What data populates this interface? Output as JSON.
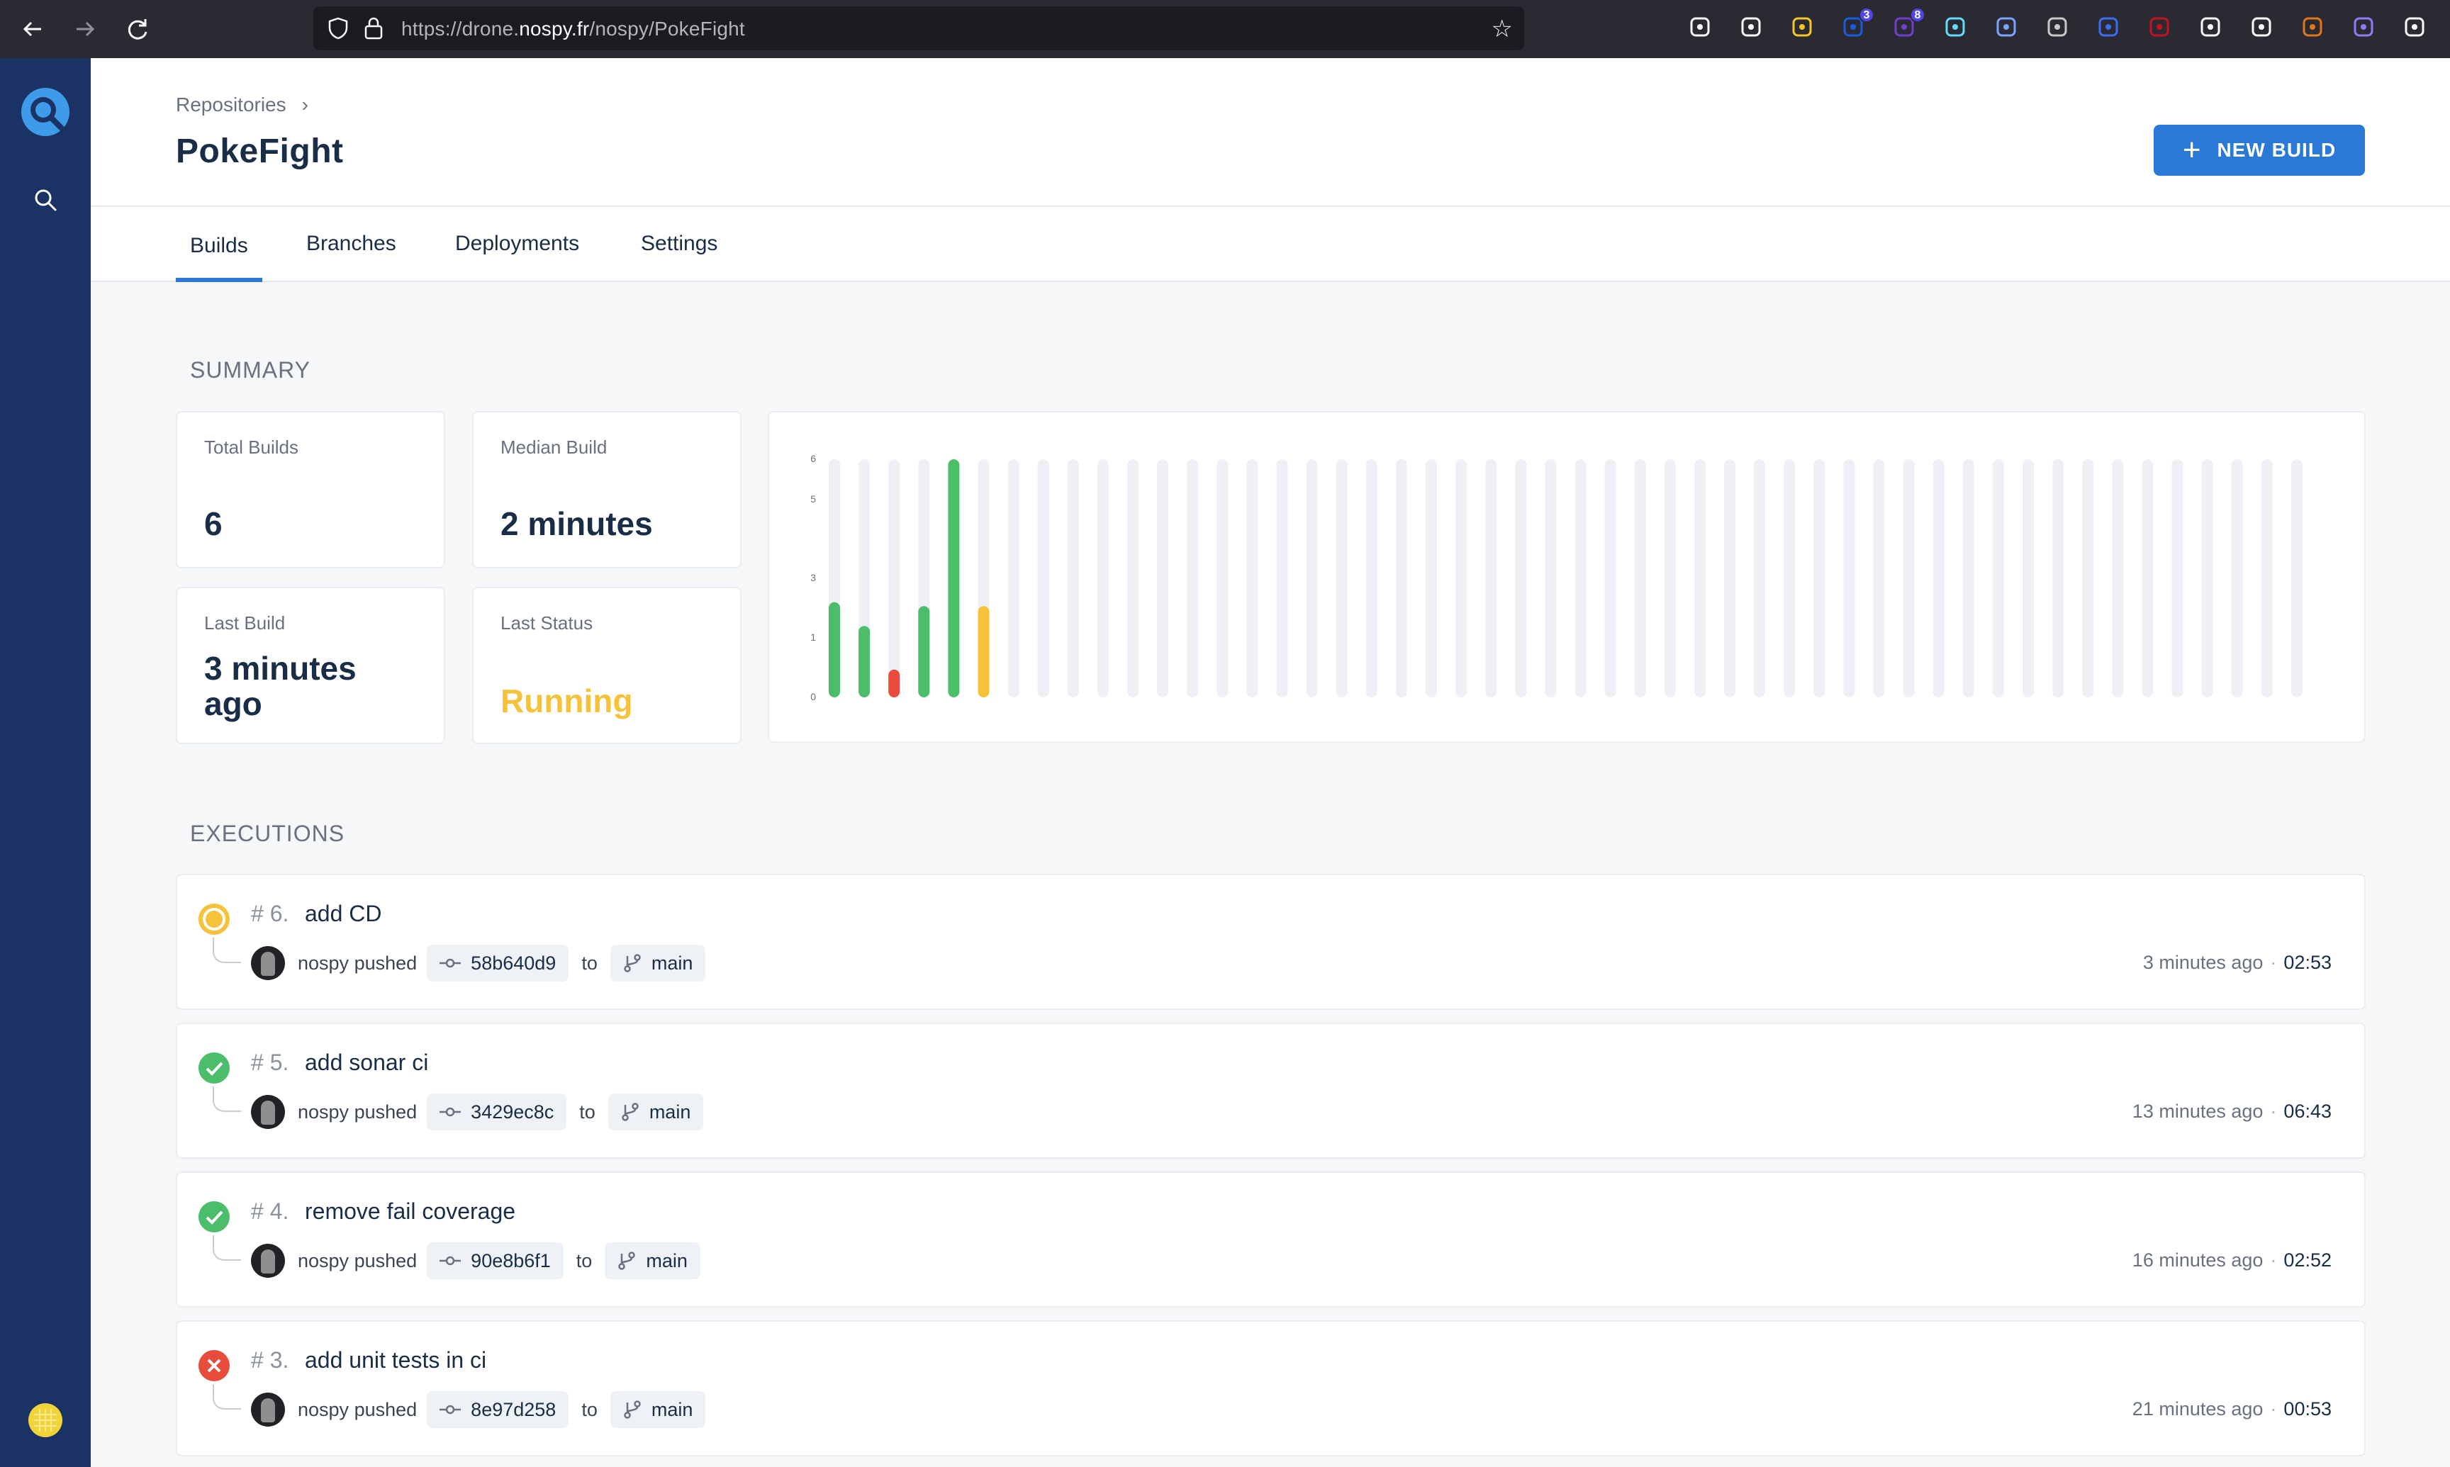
{
  "browser": {
    "url_prefix": "https://drone.",
    "url_domain": "nospy.fr",
    "url_path": "/nospy/PokeFight",
    "extensions": [
      {
        "icon": "pocket-icon",
        "color": "#fbfbfe"
      },
      {
        "icon": "download-icon",
        "color": "#fbfbfe"
      },
      {
        "icon": "wrench-icon",
        "color": "#f3c623"
      },
      {
        "icon": "bitwarden-icon",
        "color": "#175ddc",
        "badge": "3"
      },
      {
        "icon": "extension-purple-icon",
        "color": "#6d3fcf",
        "badge": "8"
      },
      {
        "icon": "react-devtools-icon",
        "color": "#61dafb"
      },
      {
        "icon": "graph-icon",
        "color": "#7aa2ff"
      },
      {
        "icon": "vue-devtools-icon",
        "color": "#c8c8c8"
      },
      {
        "icon": "link-extension-icon",
        "color": "#3b6cf6"
      },
      {
        "icon": "ublock-icon",
        "color": "#c1121f"
      },
      {
        "icon": "library-icon",
        "color": "#fbfbfe"
      },
      {
        "icon": "notion-icon",
        "color": "#ffffff"
      },
      {
        "icon": "metamask-icon",
        "color": "#e2761b"
      },
      {
        "icon": "ghost-extension-icon",
        "color": "#8b7cf6"
      },
      {
        "icon": "menu-icon",
        "color": "#fbfbfe"
      }
    ]
  },
  "header": {
    "breadcrumb": "Repositories",
    "title": "PokeFight",
    "new_build_label": "NEW BUILD"
  },
  "tabs": [
    "Builds",
    "Branches",
    "Deployments",
    "Settings"
  ],
  "summary": {
    "title": "SUMMARY",
    "total_builds_label": "Total Builds",
    "total_builds_value": "6",
    "median_build_label": "Median Build",
    "median_build_value": "2 minutes",
    "last_build_label": "Last Build",
    "last_build_value": "3 minutes ago",
    "last_status_label": "Last Status",
    "last_status_value": "Running",
    "colors": {
      "success": "#4cbe6b",
      "failure": "#e74c3c",
      "running": "#f5c23a",
      "empty": "#eef0f5",
      "accent": "#2a79d6"
    }
  },
  "chart_data": {
    "type": "bar",
    "y_ticks": [
      "6",
      "5",
      "3",
      "1",
      "0"
    ],
    "ylim": [
      0,
      6
    ],
    "slots": 50,
    "values": [
      2.4,
      1.8,
      0.7,
      2.3,
      6.5,
      2.3
    ],
    "statuses": [
      "success",
      "success",
      "failure",
      "success",
      "success",
      "running"
    ]
  },
  "executions": {
    "title": "EXECUTIONS",
    "items": [
      {
        "number": "6.",
        "title": "add CD",
        "author": "nospy",
        "action": "pushed",
        "commit": "58b640d9",
        "to": "to",
        "branch": "main",
        "time_ago": "3 minutes ago",
        "duration": "02:53",
        "status": "running"
      },
      {
        "number": "5.",
        "title": "add sonar ci",
        "author": "nospy",
        "action": "pushed",
        "commit": "3429ec8c",
        "to": "to",
        "branch": "main",
        "time_ago": "13 minutes ago",
        "duration": "06:43",
        "status": "success"
      },
      {
        "number": "4.",
        "title": "remove fail coverage",
        "author": "nospy",
        "action": "pushed",
        "commit": "90e8b6f1",
        "to": "to",
        "branch": "main",
        "time_ago": "16 minutes ago",
        "duration": "02:52",
        "status": "success"
      },
      {
        "number": "3.",
        "title": "add unit tests in ci",
        "author": "nospy",
        "action": "pushed",
        "commit": "8e97d258",
        "to": "to",
        "branch": "main",
        "time_ago": "21 minutes ago",
        "duration": "00:53",
        "status": "failure"
      }
    ]
  }
}
